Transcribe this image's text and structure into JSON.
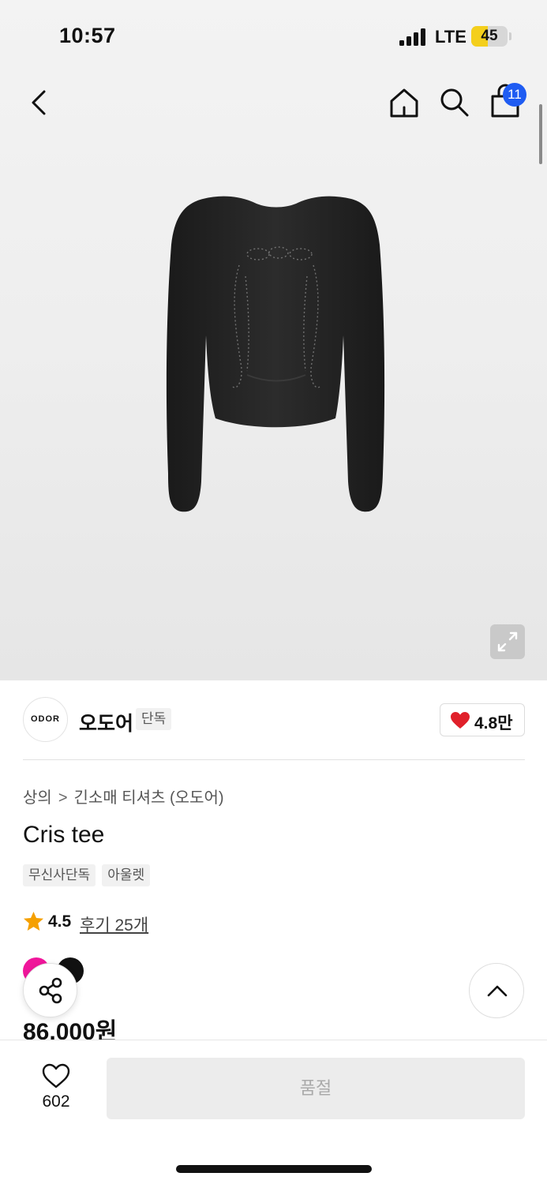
{
  "status_bar": {
    "time": "10:57",
    "network": "LTE",
    "battery_level": "45",
    "battery_fraction": 0.45
  },
  "header": {
    "icons": [
      "chevron-left-icon",
      "home-icon",
      "search-icon",
      "shopping-bag-icon"
    ],
    "cart_count": "11"
  },
  "product_image": {
    "subject": "black-long-sleeve-top",
    "expand_icon": "expand-icon"
  },
  "brand": {
    "logo_text": "ODOR",
    "name": "오도어",
    "badge": "단독",
    "likes": "4.8만",
    "like_color": "#e0202a"
  },
  "breadcrumb": {
    "category": "상의",
    "separator": ">",
    "subcategory": "긴소매 티셔츠 (오도어)"
  },
  "product": {
    "title": "Cris tee",
    "tags": [
      "무신사단독",
      "아울렛"
    ],
    "rating": "4.5",
    "reviews": "후기 25개",
    "swatches": [
      "#f0169b",
      "#111111"
    ],
    "price": "86,000원"
  },
  "actions": {
    "share_icon": "share-icon",
    "scroll_top_icon": "chevron-up-icon"
  },
  "bottom_bar": {
    "wish_count": "602",
    "button_label": "품절",
    "accent": "#1f5cf2"
  }
}
